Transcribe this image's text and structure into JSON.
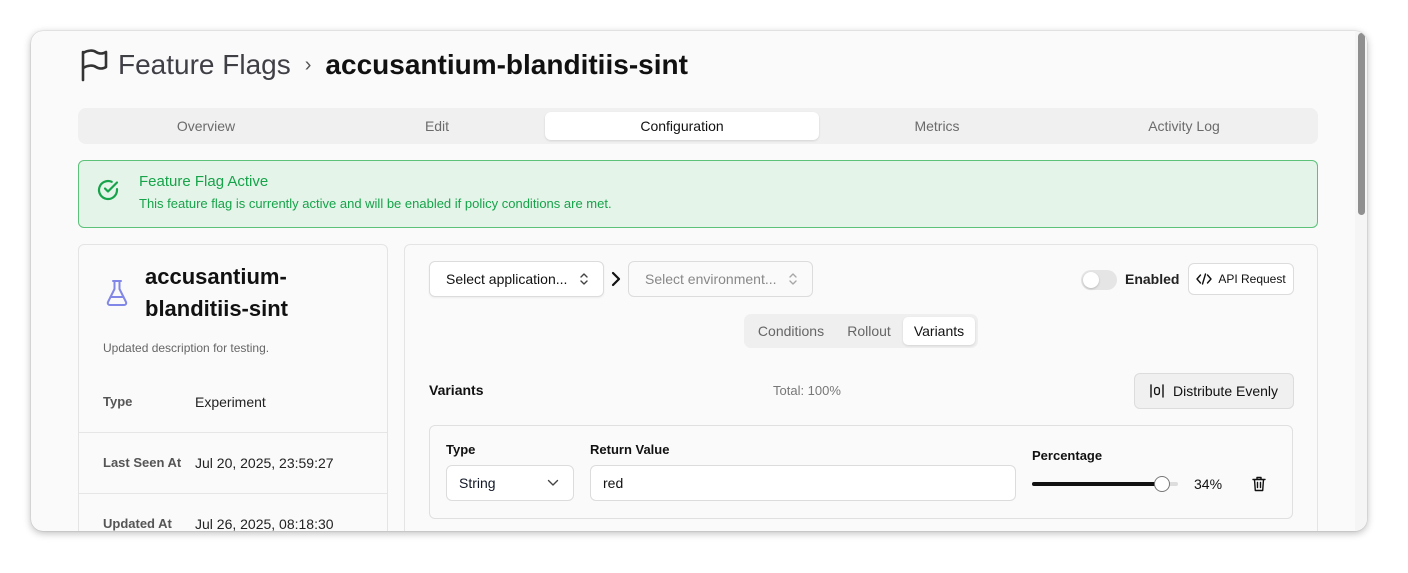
{
  "header": {
    "section": "Feature Flags",
    "separator": "›",
    "flag_name": "accusantium-blanditiis-sint"
  },
  "tabs": [
    {
      "label": "Overview",
      "active": false
    },
    {
      "label": "Edit",
      "active": false
    },
    {
      "label": "Configuration",
      "active": true
    },
    {
      "label": "Metrics",
      "active": false
    },
    {
      "label": "Activity Log",
      "active": false
    }
  ],
  "alert": {
    "title": "Feature Flag Active",
    "description": "This feature flag is currently active and will be enabled if policy conditions are met.",
    "color": "#16a34a"
  },
  "details": {
    "name": "accusantium-blanditiis-sint",
    "description": "Updated description for testing.",
    "rows": [
      {
        "key": "Type",
        "value": "Experiment"
      },
      {
        "key": "Last Seen At",
        "value": "Jul 20, 2025, 23:59:27"
      },
      {
        "key": "Updated At",
        "value": "Jul 26, 2025, 08:18:30"
      }
    ]
  },
  "config": {
    "application_placeholder": "Select application...",
    "environment_placeholder": "Select environment...",
    "enabled_label": "Enabled",
    "enabled": false,
    "api_request_label": "API Request",
    "subtabs": [
      {
        "label": "Conditions",
        "active": false
      },
      {
        "label": "Rollout",
        "active": false
      },
      {
        "label": "Variants",
        "active": true
      }
    ],
    "variants_label": "Variants",
    "total_label": "Total: 100%",
    "distribute_label": "Distribute Evenly",
    "variant": {
      "type_label": "Type",
      "type_value": "String",
      "return_value_label": "Return Value",
      "return_value": "red",
      "percentage_label": "Percentage",
      "percentage": 34,
      "percentage_text": "34%"
    }
  }
}
